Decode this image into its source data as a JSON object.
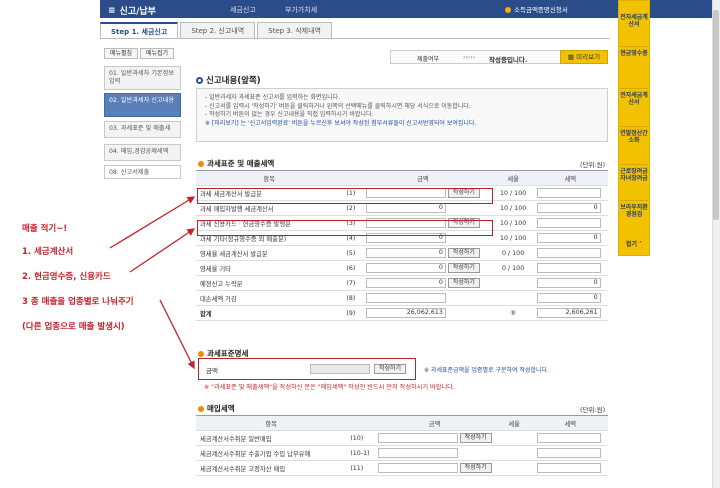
{
  "header": {
    "menu": "신고/납부",
    "crumb1": "세금신고",
    "crumb2": "부가가치세",
    "right": "소득금액증명신청서"
  },
  "tabs": [
    "Step 1. 세금신고",
    "Step 2. 신고내역",
    "Step 3. 삭제내역"
  ],
  "sidebar": {
    "btn1": "메뉴펼침",
    "btn2": "메뉴접기",
    "items": [
      "01. 일반과세자 기본정보 입력",
      "02. 일반과세자 신고내용",
      "03. 과세표준 및 매출세",
      "04. 매입,경감공제세액",
      "08. 신고서제출"
    ]
  },
  "status": {
    "label": "제출여부",
    "value": "작성중입니다.",
    "preview": "미리보기"
  },
  "content_title": "신고내용(앞쪽)",
  "notice": [
    "- 일반과세자 과세표준 신고서를 입력하는 화면입니다.",
    "- 신고서를 입력시 '작성하기' 버튼을 클릭하거나 왼쪽의 선택메뉴를 클릭하시면 해당 서식으로 이동합니다.",
    "- 작성하기 버튼이 없는 경우 신고내용을 직접 입력하시기 바랍니다.",
    "※ [미리보기] 는 '신고서입력완료' 버튼을 누르신후 보셔야 작성된 첨부서류들이 신고서반영되어 보여집니다."
  ],
  "sec1": {
    "title": "과세표준 및 매출세액",
    "unit": "(단위:원)",
    "headers": [
      "항목",
      "",
      "금액",
      "",
      "세율",
      "세액"
    ],
    "rows": [
      {
        "label": "과세 세금계산서 발급분",
        "no": "(1)",
        "amount": "",
        "btn": "작성하기",
        "rate": "10 / 100",
        "tax": ""
      },
      {
        "label": "과세 매입자발행 세금계산서",
        "no": "(2)",
        "amount": "0",
        "btn": "",
        "rate": "10 / 100",
        "tax": "0"
      },
      {
        "label": "과세 신용카드ㆍ현금영수증 발행분",
        "no": "(3)",
        "amount": "",
        "btn": "작성하기",
        "rate": "10 / 100",
        "tax": ""
      },
      {
        "label": "과세 기타(정규영수증 외 매출분)",
        "no": "(4)",
        "amount": "0",
        "btn": "",
        "rate": "10 / 100",
        "tax": "0"
      },
      {
        "label": "영세율 세금계산서 발급분",
        "no": "(5)",
        "amount": "0",
        "btn": "작성하기",
        "rate": "0 / 100",
        "tax": ""
      },
      {
        "label": "영세율 기타",
        "no": "(6)",
        "amount": "0",
        "btn": "작성하기",
        "rate": "0 / 100",
        "tax": ""
      },
      {
        "label": "예정신고 누락분",
        "no": "(7)",
        "amount": "0",
        "btn": "작성하기",
        "rate": "",
        "tax": "0"
      },
      {
        "label": "대손세액 가감",
        "no": "(8)",
        "amount": "",
        "btn": "",
        "rate": "",
        "tax": "0"
      },
      {
        "label": "합계",
        "no": "(9)",
        "amount": "26,062,613",
        "btn": "",
        "rate": "⑨",
        "tax": "2,606,261"
      }
    ]
  },
  "sec2": {
    "title": "과세표준명세",
    "label": "금액",
    "btn": "작성하기",
    "hint": "※ 과세표준금액을 업종별로 구분하여 작성합니다.",
    "warn": "※ \"과세표준 및 매출세액\"을 작성하신 분은 \"매입세액\" 작성전 반드시 먼저 작성하시기 바랍니다."
  },
  "sec3": {
    "title": "매입세액",
    "unit": "(단위:원)",
    "headers": [
      "항목",
      "",
      "금액",
      "세율",
      "세액"
    ],
    "rows": [
      {
        "label": "세금계산서수취분 일반매입",
        "no": "(10)",
        "btn": "작성하기"
      },
      {
        "label": "세금계산서수취분 수출기업 수입 납부유예",
        "no": "(10-1)",
        "btn": ""
      },
      {
        "label": "세금계산서수취분 고정자산 매입",
        "no": "(11)",
        "btn": "작성하기"
      }
    ]
  },
  "annotations": [
    "매출 적기~!",
    "1. 세금계산서",
    "2. 현금영수증, 신용카드",
    "3 종 매출을 업종별로 나눠주기",
    "(다른 업종으로 매출 발생시)"
  ],
  "yellow_bar": [
    "전자세금계산서",
    "현금영수증",
    "전자세금계산서",
    "연말정산간소화",
    "근로장려금자녀장려금",
    "브라우저환경점검",
    "접기"
  ],
  "colors": {
    "header": "#2a4d8a",
    "annotation": "#c0252a",
    "yellow": "#f2c200"
  }
}
